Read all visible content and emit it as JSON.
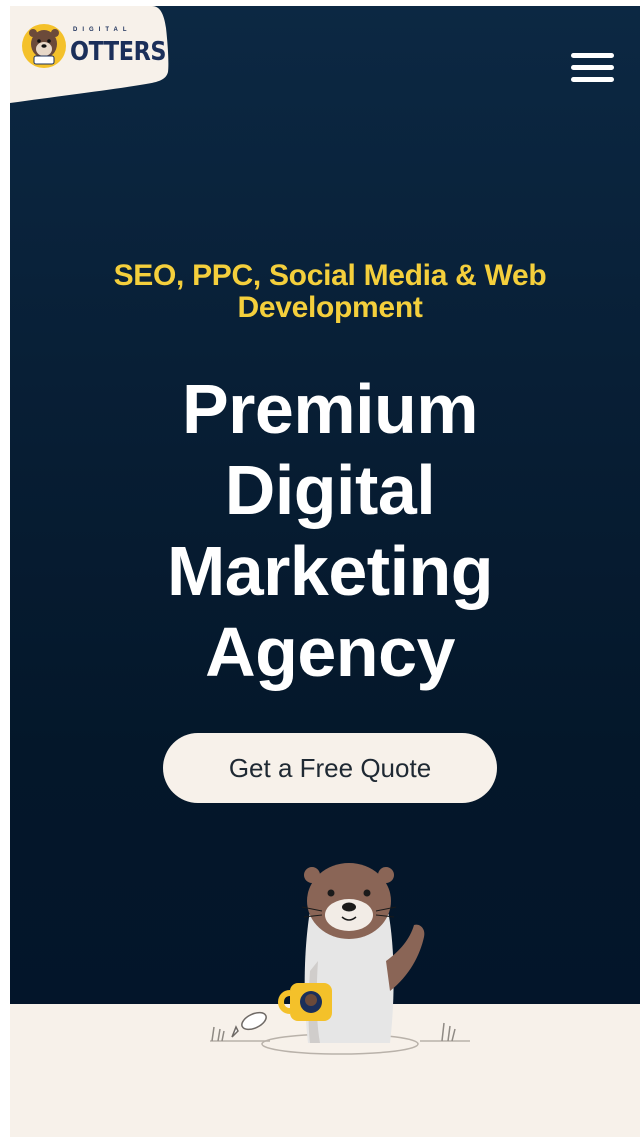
{
  "header": {
    "logo": {
      "small_text": "DIGITAL",
      "brand_text": "OTTERS",
      "icon": "otter-mascot-logo-icon"
    },
    "menu_icon": "hamburger-menu-icon"
  },
  "hero": {
    "subtitle": "SEO, PPC, Social Media & Web Development",
    "headline_lines": [
      "Premium",
      "Digital",
      "Marketing",
      "Agency"
    ],
    "cta_label": "Get a Free Quote",
    "illustration": "otter-with-mug-illustration"
  },
  "colors": {
    "hero_background": "#071d33",
    "accent_yellow": "#f4cf3c",
    "cream": "#f7f1ea",
    "brand_navy": "#1b2f5a"
  }
}
